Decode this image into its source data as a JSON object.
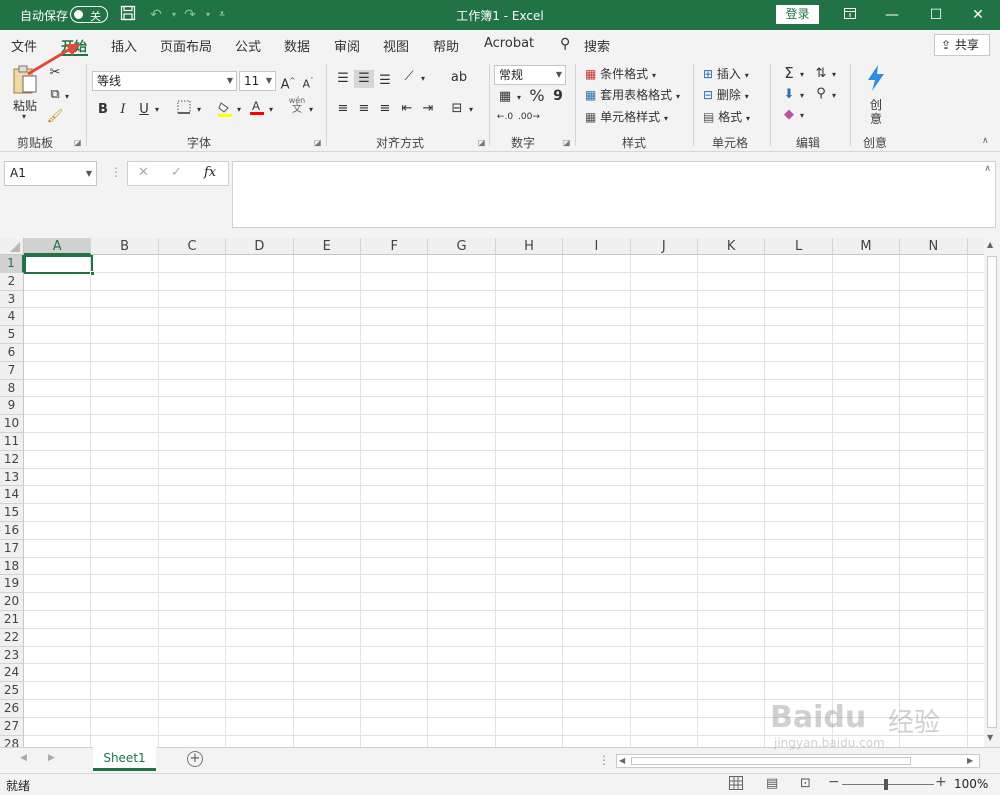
{
  "titlebar": {
    "autosave_label": "自动保存",
    "autosave_state": "关",
    "title": "工作簿1  -  Excel",
    "login": "登录",
    "icons": [
      "save-icon",
      "undo-icon",
      "redo-icon",
      "customize-icon"
    ]
  },
  "tabs": [
    "文件",
    "开始",
    "插入",
    "页面布局",
    "公式",
    "数据",
    "审阅",
    "视图",
    "帮助",
    "Acrobat"
  ],
  "active_tab": "开始",
  "search_label": "搜索",
  "share_label": "共享",
  "ribbon": {
    "clipboard": {
      "paste": "粘贴",
      "label": "剪贴板"
    },
    "font": {
      "name": "等线",
      "size": "11",
      "grow": "A",
      "shrink": "A",
      "bold": "B",
      "italic": "I",
      "underline": "U",
      "fill_color": "#ffff00",
      "font_color": "#ff0000",
      "label": "字体",
      "phonetic_top": "wén",
      "phonetic_bottom": "文"
    },
    "alignment": {
      "label": "对齐方式"
    },
    "number": {
      "format": "常规",
      "percent": "%",
      "comma": "9",
      "label": "数字"
    },
    "styles": {
      "conditional": "条件格式",
      "table": "套用表格格式",
      "cell": "单元格样式",
      "label": "样式"
    },
    "cells": {
      "insert": "插入",
      "delete": "删除",
      "format": "格式",
      "label": "单元格"
    },
    "editing": {
      "label": "编辑"
    },
    "ideas": {
      "line1": "创",
      "line2": "意",
      "label": "创意"
    }
  },
  "formula_bar": {
    "name_box": "A1",
    "fx": "fx"
  },
  "grid": {
    "columns": [
      "A",
      "B",
      "C",
      "D",
      "E",
      "F",
      "G",
      "H",
      "I",
      "J",
      "K",
      "L",
      "M",
      "N"
    ],
    "rows": [
      "1",
      "2",
      "3",
      "4",
      "5",
      "6",
      "7",
      "8",
      "9",
      "10",
      "11",
      "12",
      "13",
      "14",
      "15",
      "16",
      "17",
      "18",
      "19",
      "20",
      "21",
      "22",
      "23",
      "24",
      "25",
      "26",
      "27",
      "28"
    ],
    "selected_cell": "A1"
  },
  "sheets": [
    "Sheet1"
  ],
  "status": {
    "ready": "就绪",
    "zoom": "100%"
  },
  "watermark": {
    "brand": "Baidu",
    "cn": "经验",
    "url": "jingyan.baidu.com"
  },
  "colors": {
    "accent": "#217346",
    "arrow": "#e04a3a"
  }
}
